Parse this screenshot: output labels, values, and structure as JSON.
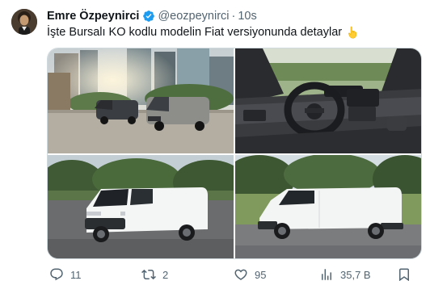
{
  "tweet": {
    "author_name": "Emre Özpeynirci",
    "handle": "@eozpeynirci",
    "separator": "·",
    "time": "10s",
    "text": "İşte Bursalı KO kodlu modelin Fiat versiyonunda detaylar"
  },
  "media": [
    {
      "name": "two-vans-in-city"
    },
    {
      "name": "van-interior-dashboard"
    },
    {
      "name": "van-front-three-quarter"
    },
    {
      "name": "van-side-profile"
    }
  ],
  "actions": {
    "replies": "11",
    "retweets": "2",
    "likes": "95",
    "views": "35,7 B"
  },
  "colors": {
    "text": "#0f1419",
    "secondary": "#536471",
    "verified": "#1d9bf0",
    "border": "#cfd9de"
  }
}
